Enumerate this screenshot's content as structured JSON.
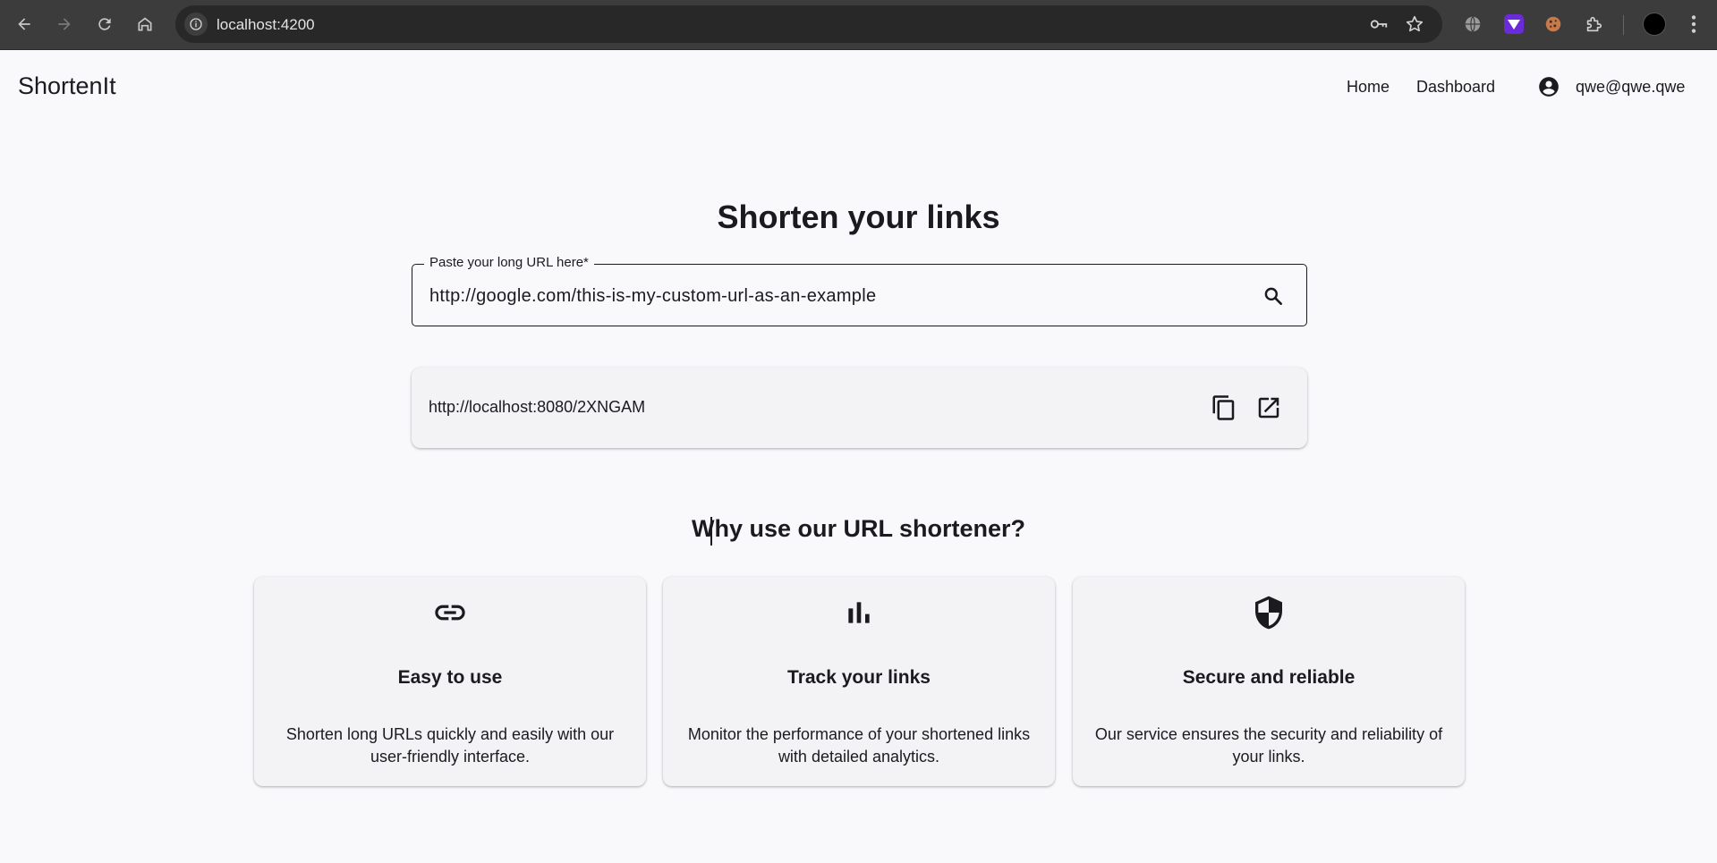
{
  "browser": {
    "url": "localhost:4200"
  },
  "header": {
    "brand": "ShortenIt",
    "nav": [
      {
        "label": "Home"
      },
      {
        "label": "Dashboard"
      }
    ],
    "account_email": "qwe@qwe.qwe"
  },
  "main": {
    "title": "Shorten your links",
    "url_input": {
      "label": "Paste your long URL here*",
      "value": "http://google.com/this-is-my-custom-url-as-an-example"
    },
    "result": {
      "short_url": "http://localhost:8080/2XNGAM"
    },
    "why_title": "Why use our URL shortener?",
    "features": [
      {
        "icon": "link-icon",
        "title": "Easy to use",
        "description": "Shorten long URLs quickly and easily with our user-friendly interface."
      },
      {
        "icon": "bar-chart-icon",
        "title": "Track your links",
        "description": "Monitor the performance of your shortened links with detailed analytics."
      },
      {
        "icon": "shield-icon",
        "title": "Secure and reliable",
        "description": "Our service ensures the security and reliability of your links."
      }
    ]
  }
}
